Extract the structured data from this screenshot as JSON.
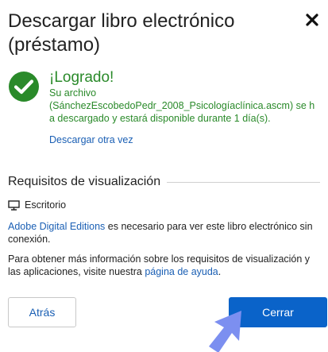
{
  "dialog": {
    "title": "Descargar libro electrónico (préstamo)",
    "close_icon": "close-icon"
  },
  "success": {
    "icon": "check-circle-icon",
    "color": "#2a8a2a",
    "title": "¡Logrado!",
    "line1": "Su archivo",
    "message": "(SánchezEscobedoPedr_2008_Psicologíaclínica.ascm) se ha descargado y estará disponible durante 1 día(s).",
    "redownload_label": "Descargar otra vez"
  },
  "requirements": {
    "heading": "Requisitos de visualización",
    "platform_icon": "monitor-icon",
    "platform_label": "Escritorio",
    "adobe_link": "Adobe Digital Editions",
    "adobe_text": " es necesario para ver este libro electrónico sin conexión.",
    "info_text": "Para obtener más información sobre los requisitos de visualización y las aplicaciones, visite nuestra ",
    "help_link": "página de ayuda",
    "info_end": "."
  },
  "buttons": {
    "back_label": "Atrás",
    "close_label": "Cerrar"
  },
  "colors": {
    "link": "#1a5fb4",
    "primary": "#0a63c9",
    "cursor": "#7c8ff0"
  }
}
